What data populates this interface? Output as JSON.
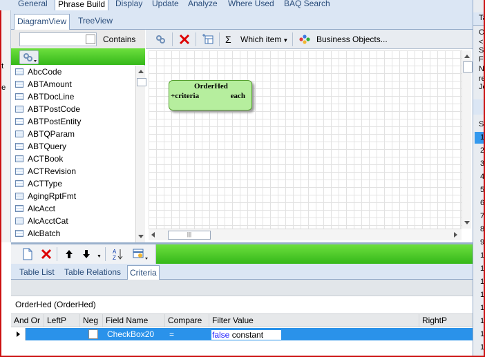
{
  "top_tabs": [
    "General",
    "Phrase Build",
    "Display",
    "Update",
    "Analyze",
    "Where Used",
    "BAQ Search"
  ],
  "view_tabs": [
    "DiagramView",
    "TreeView"
  ],
  "left_edge_text": [
    "nt",
    "ne"
  ],
  "table_filter": {
    "value": "",
    "contains_label": "Contains",
    "contains_checked": false
  },
  "tables": [
    "AbcCode",
    "ABTAmount",
    "ABTDocLine",
    "ABTPostCode",
    "ABTPostEntity",
    "ABTQParam",
    "ABTQuery",
    "ACTBook",
    "ACTRevision",
    "ACTType",
    "AgingRptFmt",
    "AlcAcct",
    "AlcAcctCat",
    "AlcBatch"
  ],
  "diagram_toolbar": {
    "sum_symbol": "Σ",
    "which_item_label": "Which item",
    "business_objects_label": "Business Objects..."
  },
  "entity": {
    "title": "OrderHed",
    "left_text": "+criteria",
    "right_text": "each"
  },
  "bottom_tabs": [
    "Table List",
    "Table Relations",
    "Criteria"
  ],
  "criteria_caption": "OrderHed (OrderHed)",
  "criteria_columns": [
    "And Or",
    "LeftP",
    "Neg",
    "Field Name",
    "Compare",
    "Filter Value",
    "RightP"
  ],
  "criteria_rows": [
    {
      "and_or": "",
      "leftp": "",
      "neg": false,
      "field_name": "CheckBox20",
      "compare": "=",
      "filter_value_keyword": "false",
      "filter_value_type": "constant",
      "rightp": ""
    }
  ],
  "right_cut_text": [
    "Ta",
    "O",
    "<",
    "S",
    "F",
    "N",
    "re",
    "Jo"
  ],
  "right_cut_list_head": "Se",
  "right_cut_numbers": [
    "1",
    "2",
    "3",
    "4",
    "5",
    "6",
    "7",
    "8",
    "9",
    "1",
    "1",
    "1",
    "1",
    "1",
    "1",
    "1",
    "1"
  ],
  "colors": {
    "green_toolbar": "#35b81a",
    "selection": "#2a92ea",
    "window_border": "#cc1111",
    "keyword_blue": "#1a1aff"
  }
}
